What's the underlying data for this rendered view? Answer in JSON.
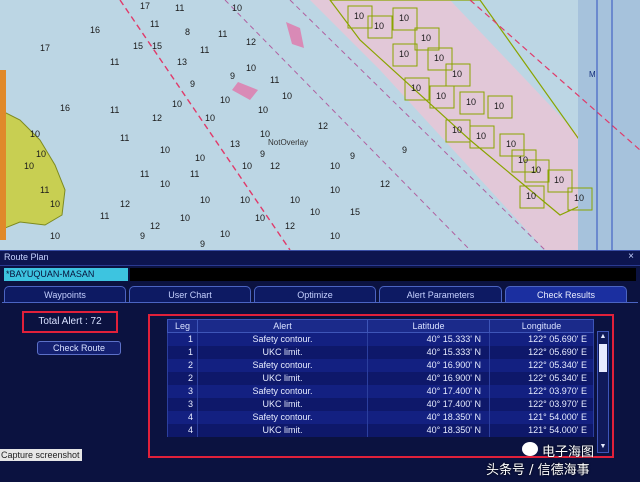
{
  "chart": {
    "soundings": [
      "17",
      "11",
      "10",
      "11",
      "8",
      "11",
      "16",
      "15",
      "15",
      "11",
      "12",
      "17",
      "11",
      "13",
      "10",
      "9",
      "11",
      "10",
      "9",
      "10",
      "10",
      "10",
      "11",
      "12",
      "10",
      "12",
      "11",
      "10",
      "13",
      "9",
      "9",
      "9",
      "10",
      "10",
      "12",
      "10",
      "11",
      "11",
      "10",
      "10",
      "12",
      "15",
      "10",
      "10",
      "10",
      "10",
      "10",
      "10",
      "12",
      "10",
      "10",
      "12",
      "12",
      "11",
      "9",
      "9",
      "11",
      "10",
      "10",
      "10",
      "10",
      "16",
      "10",
      "10"
    ],
    "cells": [
      "10",
      "10",
      "10",
      "10",
      "10",
      "10",
      "10",
      "10",
      "10",
      "10",
      "10",
      "10",
      "10",
      "10",
      "10",
      "10",
      "10",
      "10",
      "10"
    ],
    "overlay_text": "NotOverlay",
    "edge_letter": "M",
    "colors": {
      "water": "#bcd6e4",
      "lane": "#e2c8d8",
      "route": "#e03a6a",
      "cells": "#8aa400",
      "land": "#c8cf52"
    }
  },
  "panel": {
    "title": "Route Plan",
    "close_glyph": "×",
    "route_name": "*BAYUQUAN-MASAN",
    "tabs": [
      "Waypoints",
      "User Chart",
      "Optimize",
      "Alert Parameters",
      "Check Results"
    ],
    "total_alert": "Total Alert :  72",
    "check_route_label": "Check Route",
    "table": {
      "headers": [
        "Leg",
        "Alert",
        "Latitude",
        "Longitude"
      ],
      "rows": [
        [
          "1",
          "Safety contour.",
          "40° 15.333' N",
          "122° 05.690' E"
        ],
        [
          "1",
          "UKC limit.",
          "40° 15.333' N",
          "122° 05.690' E"
        ],
        [
          "2",
          "Safety contour.",
          "40° 16.900' N",
          "122° 05.340' E"
        ],
        [
          "2",
          "UKC limit.",
          "40° 16.900' N",
          "122° 05.340' E"
        ],
        [
          "3",
          "Safety contour.",
          "40° 17.400' N",
          "122° 03.970' E"
        ],
        [
          "3",
          "UKC limit.",
          "40° 17.400' N",
          "122° 03.970' E"
        ],
        [
          "4",
          "Safety contour.",
          "40° 18.350' N",
          "121° 54.000' E"
        ],
        [
          "4",
          "UKC limit.",
          "40° 18.350' N",
          "121° 54.000' E"
        ]
      ]
    }
  },
  "capture_label": "Capture screenshot",
  "watermark": {
    "line1": "电子海图",
    "line2": "头条号 / 信德海事"
  }
}
